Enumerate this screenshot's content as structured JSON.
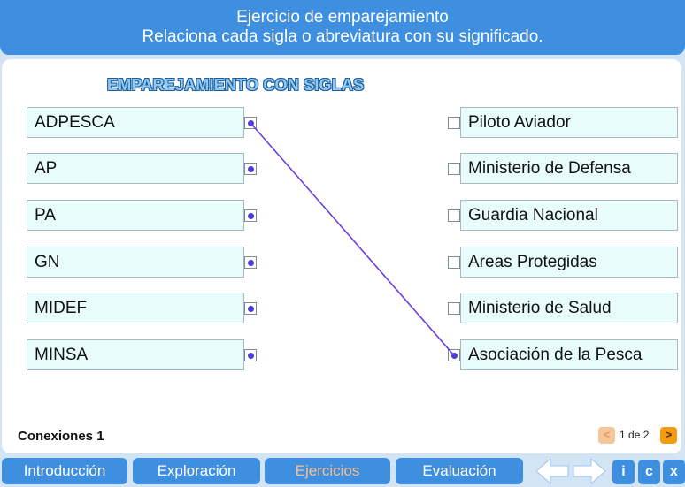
{
  "header": {
    "line1": "Ejercicio de emparejamiento",
    "line2": "Relaciona cada sigla o abreviatura con su significado."
  },
  "exercise": {
    "title": "EMPAREJAMIENTO CON SIGLAS",
    "left_items": [
      "ADPESCA",
      "AP",
      "PA",
      "GN",
      "MIDEF",
      "MINSA"
    ],
    "right_items": [
      "Piloto Aviador",
      "Ministerio de Defensa",
      "Guardia Nacional",
      "Areas Protegidas",
      "Ministerio de Salud",
      "Asociación de la Pesca"
    ],
    "connections": [
      {
        "from": "ADPESCA",
        "to": "Asociación de la Pesca"
      }
    ],
    "connector_color": "#6a3ee0",
    "box_color": "#e8fcfc"
  },
  "status": {
    "connections_label": "Conexiones",
    "connections_count": "1"
  },
  "pager": {
    "prev_label": "<",
    "next_label": ">",
    "current": "1",
    "of": "de",
    "total": "2"
  },
  "nav": {
    "tabs": [
      {
        "label": "Introducción",
        "active": false
      },
      {
        "label": "Exploración",
        "active": false
      },
      {
        "label": "Ejercicios",
        "active": true
      },
      {
        "label": "Evaluación",
        "active": false
      }
    ],
    "back_icon": "arrow-left-icon",
    "forward_icon": "arrow-right-icon",
    "info_label": "i",
    "credits_label": "c",
    "close_label": "x"
  },
  "colors": {
    "header_bg": "#3f8fe0",
    "page_bg": "#d3e4f4",
    "active_tab_text": "#f6c090"
  }
}
